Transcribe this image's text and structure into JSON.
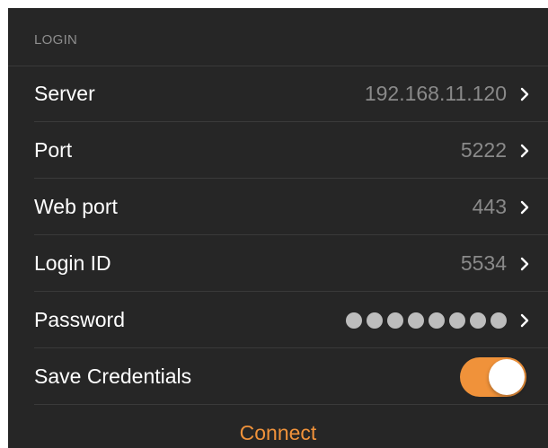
{
  "section": {
    "header": "LOGIN"
  },
  "rows": [
    {
      "label": "Server",
      "value": "192.168.11.120"
    },
    {
      "label": "Port",
      "value": "5222"
    },
    {
      "label": "Web port",
      "value": "443"
    },
    {
      "label": "Login ID",
      "value": "5534"
    },
    {
      "label": "Password",
      "value": "●●●●●●●●"
    }
  ],
  "save_credentials": {
    "label": "Save Credentials",
    "enabled": true
  },
  "connect": {
    "label": "Connect"
  },
  "colors": {
    "background": "#262626",
    "accent": "#f0923a",
    "label": "#ffffff",
    "value": "#8a8a8a",
    "header": "#8e8e8e"
  },
  "icons": {
    "row_disclosure": "chevron-right-icon"
  }
}
